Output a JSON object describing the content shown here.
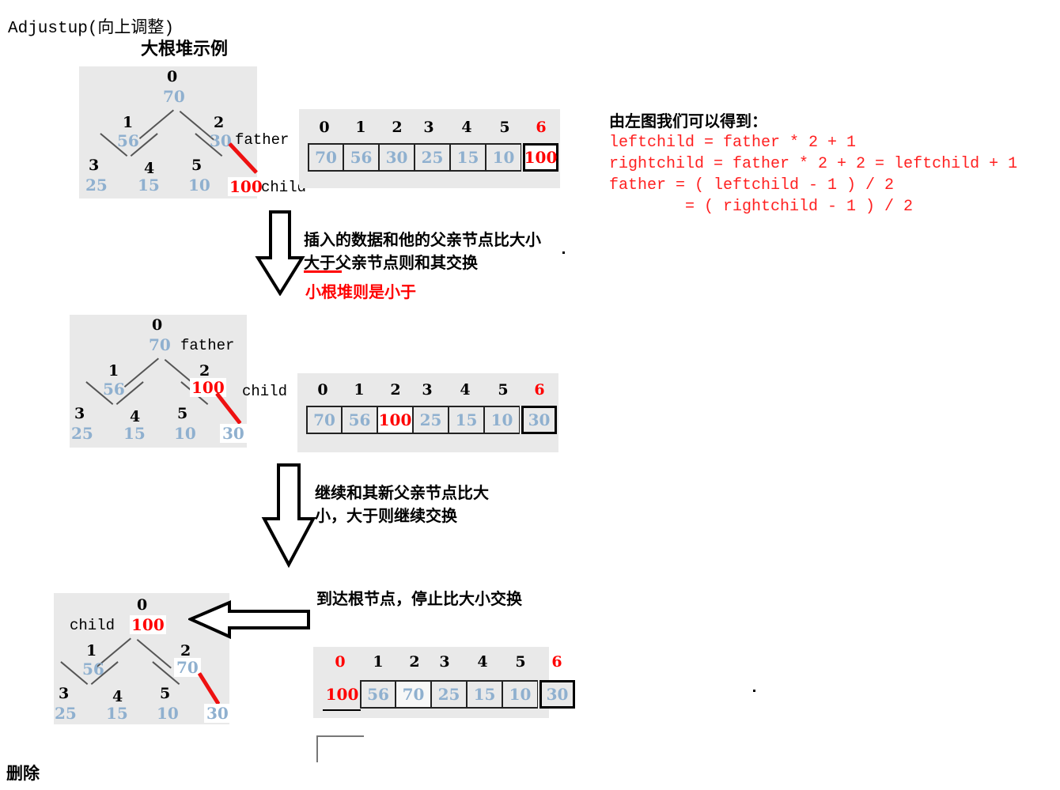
{
  "headings": {
    "main_title": "Adjustup(向上调整)",
    "subtitle": "大根堆示例",
    "footer": "删除"
  },
  "formulas": {
    "intro": "由左图我们可以得到：",
    "lines": [
      "leftchild = father * 2 + 1",
      "rightchild = father * 2 + 2 = leftchild + 1",
      "father = ( leftchild - 1 ) / 2",
      "        = ( rightchild - 1 ) / 2"
    ]
  },
  "steps": [
    {
      "tree": {
        "indices": [
          "0",
          "1",
          "2",
          "3",
          "4",
          "5"
        ],
        "values": [
          "70",
          "56",
          "30",
          "25",
          "15",
          "10"
        ],
        "extra_value": "100",
        "labels": {
          "father": "father",
          "child": "child"
        }
      },
      "array": {
        "indices": [
          "0",
          "1",
          "2",
          "3",
          "4",
          "5",
          "6"
        ],
        "values": [
          "70",
          "56",
          "30",
          "25",
          "15",
          "10",
          "100"
        ]
      },
      "note": {
        "line1": "插入的数据和他的父亲节点比大小",
        "line2": "大于父亲节点则和其交换",
        "line3": "小根堆则是小于"
      }
    },
    {
      "tree": {
        "indices": [
          "0",
          "1",
          "2",
          "3",
          "4",
          "5"
        ],
        "values": [
          "70",
          "56",
          "100",
          "25",
          "15",
          "10"
        ],
        "extra_value": "30",
        "labels": {
          "father": "father",
          "child": "child"
        }
      },
      "array": {
        "indices": [
          "0",
          "1",
          "2",
          "3",
          "4",
          "5",
          "6"
        ],
        "values": [
          "70",
          "56",
          "100",
          "25",
          "15",
          "10",
          "30"
        ]
      },
      "note": {
        "line1": "继续和其新父亲节点比大",
        "line2": "小，大于则继续交换"
      }
    },
    {
      "tree": {
        "indices": [
          "0",
          "1",
          "2",
          "3",
          "4",
          "5"
        ],
        "values": [
          "100",
          "56",
          "70",
          "25",
          "15",
          "10"
        ],
        "extra_value": "30",
        "labels": {
          "child": "child"
        }
      },
      "array": {
        "indices": [
          "0",
          "1",
          "2",
          "3",
          "4",
          "5",
          "6"
        ],
        "values": [
          "100",
          "56",
          "70",
          "25",
          "15",
          "10",
          "30"
        ]
      },
      "note": {
        "line1": "到达根节点，停止比大小交换"
      }
    }
  ],
  "colors": {
    "highlight_red": "#ff0000",
    "node_blue": "#8fb0cf",
    "panel_gray": "#e9e9e9",
    "edge_gray": "#555555"
  }
}
